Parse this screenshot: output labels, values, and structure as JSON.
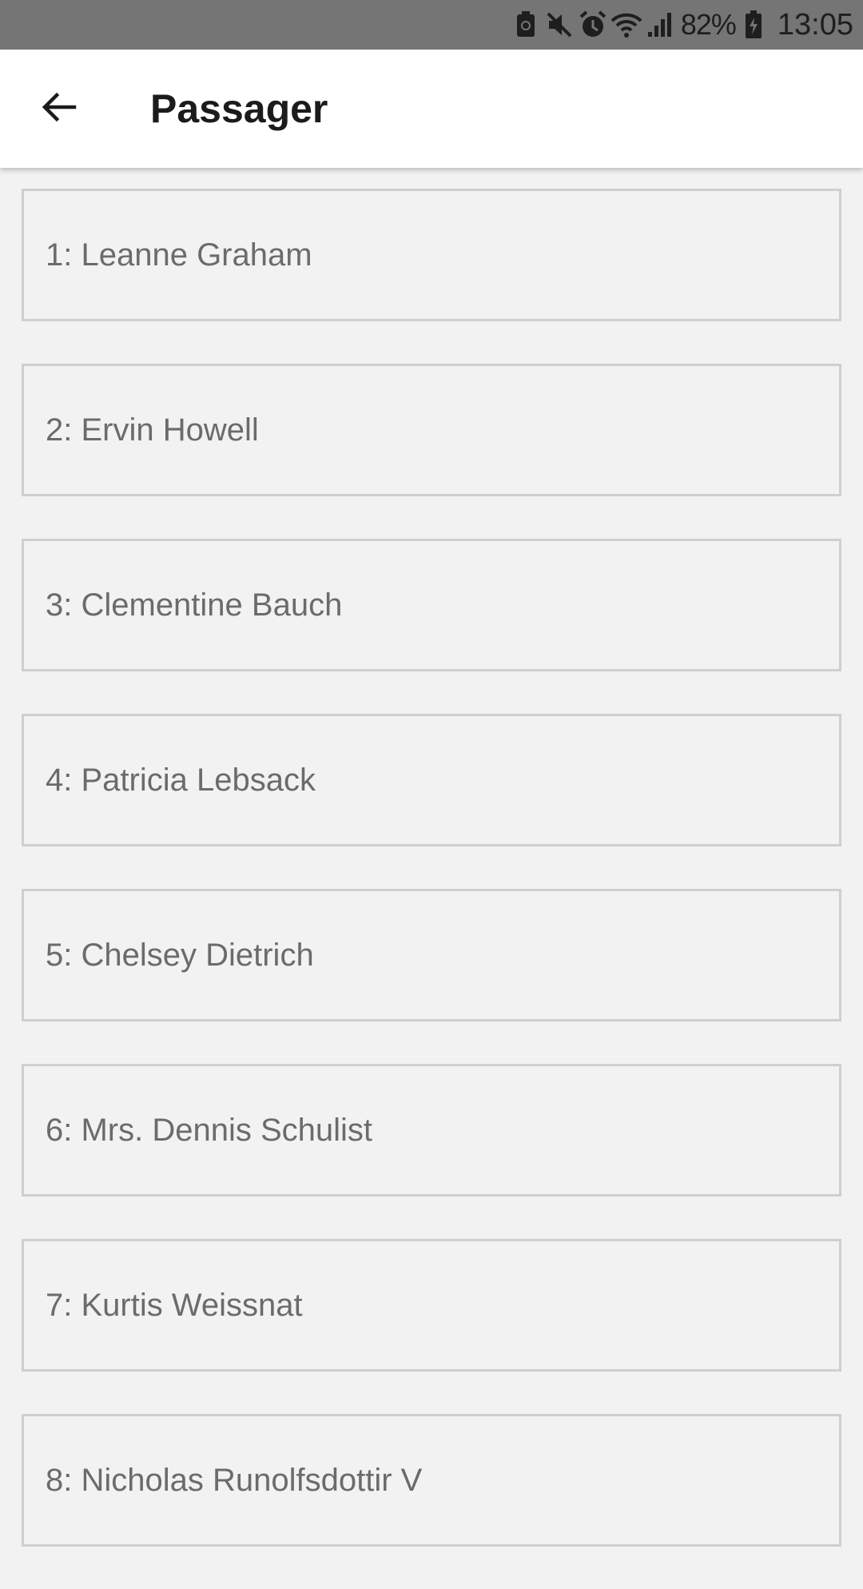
{
  "status_bar": {
    "battery_percent": "82%",
    "time": "13:05",
    "icons": [
      "android-notification-icon",
      "muted-icon",
      "alarm-icon",
      "wifi-icon",
      "signal-icon",
      "battery-charging-icon"
    ]
  },
  "app_bar": {
    "title": "Passager",
    "back_icon": "arrow-back-icon"
  },
  "passengers": [
    {
      "label": "1: Leanne Graham"
    },
    {
      "label": "2: Ervin Howell"
    },
    {
      "label": "3: Clementine Bauch"
    },
    {
      "label": "4: Patricia Lebsack"
    },
    {
      "label": "5: Chelsey Dietrich"
    },
    {
      "label": "6: Mrs. Dennis Schulist"
    },
    {
      "label": "7: Kurtis Weissnat"
    },
    {
      "label": "8: Nicholas Runolfsdottir V"
    }
  ],
  "colors": {
    "status_bar": "#757575",
    "app_bar": "#ffffff",
    "background": "#f2f2f2",
    "item_border": "#cfcfcf",
    "item_text": "#6b6b6b"
  }
}
